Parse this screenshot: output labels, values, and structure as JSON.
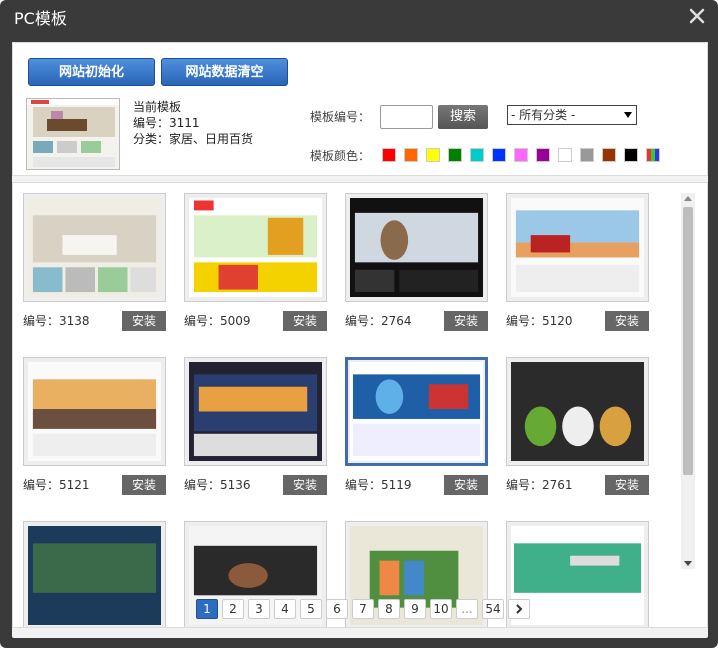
{
  "window": {
    "title": "PC模板"
  },
  "actions": {
    "init_label": "网站初始化",
    "clear_label": "网站数据清空"
  },
  "current": {
    "heading": "当前模板",
    "number": "编号：3111",
    "category": "分类：家居、日用百货"
  },
  "filters": {
    "code_label": "模板编号：",
    "search_label": "搜索",
    "category_selected": "- 所有分类 -",
    "color_label": "模板颜色："
  },
  "colors": [
    "#ff0000",
    "#ff6600",
    "#ffff00",
    "#008000",
    "#00cccc",
    "#0033ff",
    "#ff66ff",
    "#990099",
    "#ffffff",
    "#999999",
    "#993300",
    "#000000",
    "multi"
  ],
  "templates": [
    {
      "id": "编号：3138",
      "install": "安装",
      "theme": "home"
    },
    {
      "id": "编号：5009",
      "install": "安装",
      "theme": "food"
    },
    {
      "id": "编号：2764",
      "install": "安装",
      "theme": "bird"
    },
    {
      "id": "编号：5120",
      "install": "安装",
      "theme": "truck"
    },
    {
      "id": "编号：5121",
      "install": "安装",
      "theme": "port"
    },
    {
      "id": "编号：5136",
      "install": "安装",
      "theme": "logistics"
    },
    {
      "id": "编号：5119",
      "install": "安装",
      "theme": "globe"
    },
    {
      "id": "编号：2761",
      "install": "安装",
      "theme": "personal"
    },
    {
      "id": "",
      "install": "",
      "theme": "electronics"
    },
    {
      "id": "",
      "install": "",
      "theme": "jewelry"
    },
    {
      "id": "",
      "install": "",
      "theme": "books"
    },
    {
      "id": "",
      "install": "",
      "theme": "green"
    }
  ],
  "pagination": {
    "pages": [
      "1",
      "2",
      "3",
      "4",
      "5",
      "6",
      "7",
      "8",
      "9",
      "10",
      "...",
      "54"
    ],
    "active": "1"
  }
}
